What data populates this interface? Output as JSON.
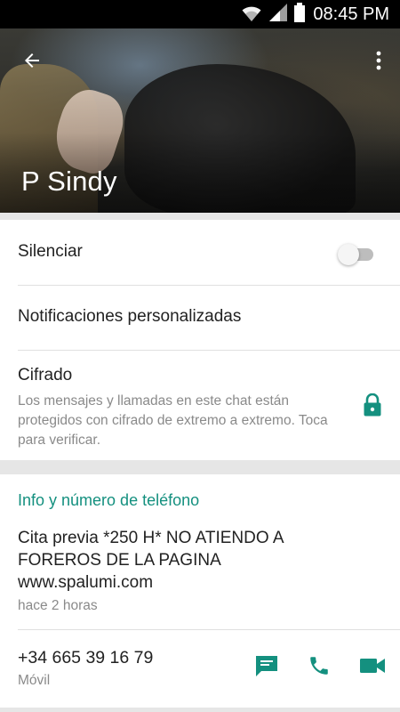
{
  "status_bar": {
    "time": "08:45 PM",
    "icons": [
      "wifi-icon",
      "signal-icon",
      "battery-icon"
    ]
  },
  "header": {
    "contact_name": "P Sindy",
    "back_icon": "arrow-back-icon",
    "menu_icon": "more-vert-icon"
  },
  "settings": {
    "mute_label": "Silenciar",
    "mute_enabled": false,
    "custom_notifications_label": "Notificaciones personalizadas",
    "encryption_label": "Cifrado",
    "encryption_description": "Los mensajes y llamadas en este chat están protegidos con cifrado de extremo a extremo. Toca para verificar.",
    "encryption_icon": "lock-icon"
  },
  "info": {
    "section_title": "Info y número de teléfono",
    "about_text": "Cita previa *250 H* NO ATIENDO  A\nFOREROS DE LA PAGINA\nwww.spalumi.com",
    "about_time": "hace 2 horas",
    "phone_number": "+34 665 39 16 79",
    "phone_type": "Móvil",
    "actions": [
      "message-icon",
      "phone-icon",
      "video-call-icon"
    ]
  },
  "colors": {
    "accent": "#14907f",
    "status_bar": "#000000",
    "toggle_off": "#bdbdbd"
  }
}
